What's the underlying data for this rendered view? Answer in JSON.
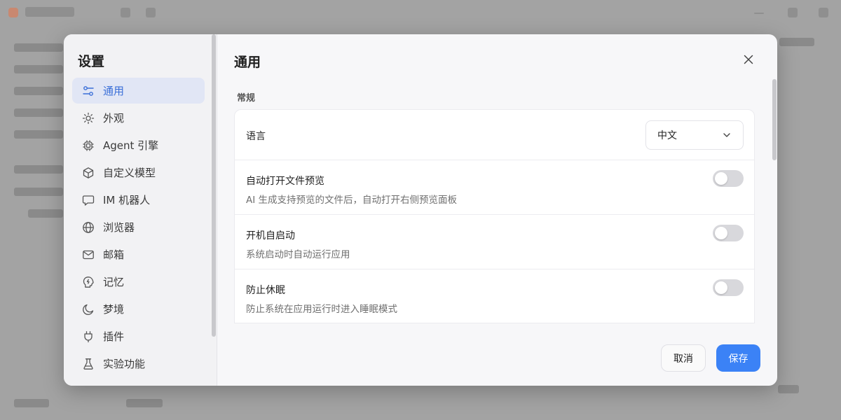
{
  "sidebar": {
    "title": "设置",
    "items": [
      {
        "label": "通用",
        "icon": "sliders-icon",
        "active": true
      },
      {
        "label": "外观",
        "icon": "sun-icon"
      },
      {
        "label": "Agent 引擎",
        "icon": "chip-icon"
      },
      {
        "label": "自定义模型",
        "icon": "cube-icon"
      },
      {
        "label": "IM 机器人",
        "icon": "chat-bubble-icon"
      },
      {
        "label": "浏览器",
        "icon": "globe-icon"
      },
      {
        "label": "邮箱",
        "icon": "mail-icon"
      },
      {
        "label": "记忆",
        "icon": "brain-bolt-icon"
      },
      {
        "label": "梦境",
        "icon": "moon-icon"
      },
      {
        "label": "插件",
        "icon": "plug-icon"
      },
      {
        "label": "实验功能",
        "icon": "flask-icon"
      }
    ]
  },
  "main": {
    "title": "通用",
    "section_label": "常规",
    "language": {
      "label": "语言",
      "value": "中文"
    },
    "toggles": [
      {
        "label": "自动打开文件预览",
        "description": "AI 生成支持预览的文件后，自动打开右侧预览面板",
        "on": false
      },
      {
        "label": "开机自启动",
        "description": "系统启动时自动运行应用",
        "on": false
      },
      {
        "label": "防止休眠",
        "description": "防止系统在应用运行时进入睡眠模式",
        "on": false
      }
    ]
  },
  "footer": {
    "cancel_label": "取消",
    "save_label": "保存"
  },
  "colors": {
    "accent": "#3b82f6",
    "active_bg": "#e1e6f5",
    "toggle_off": "#d8d8dc"
  }
}
